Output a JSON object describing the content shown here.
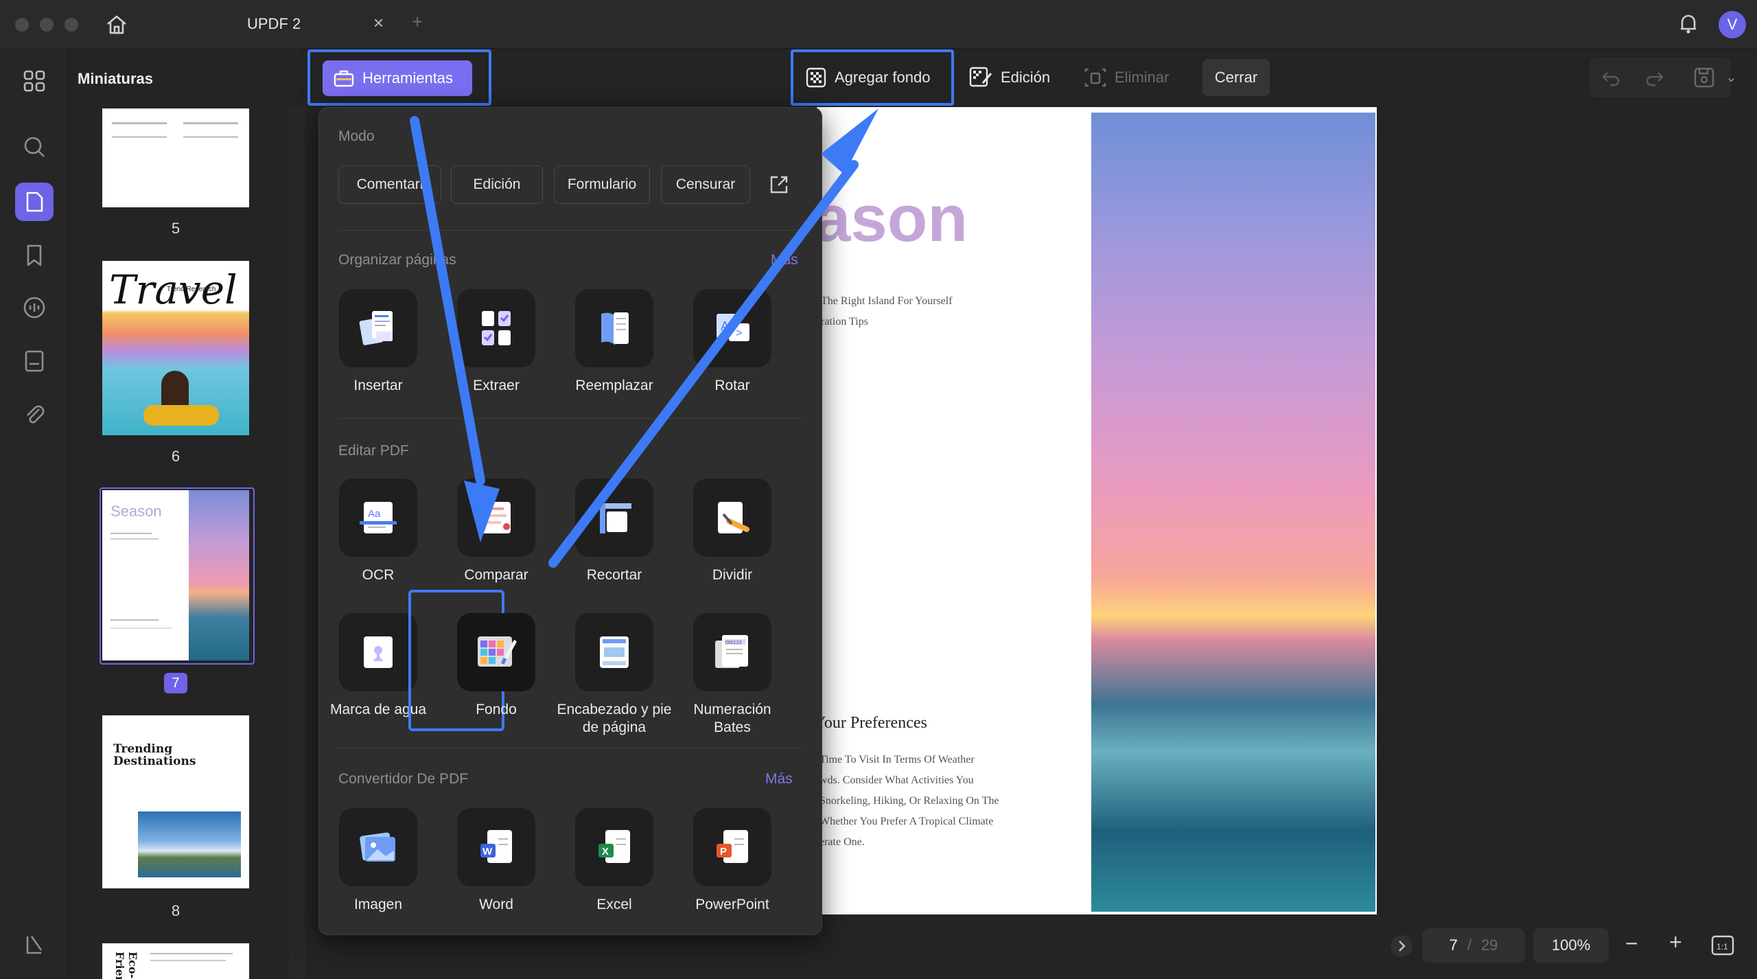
{
  "window": {
    "tab_title": "UPDF 2"
  },
  "sidebar": {
    "panel_title": "Miniaturas",
    "avatar_letter": "V"
  },
  "thumbnails": [
    {
      "page": "5"
    },
    {
      "page": "6",
      "title": "Travel",
      "subtitle": "Trend Research"
    },
    {
      "page": "7",
      "title": "Season"
    },
    {
      "page": "8",
      "title": "Trending Destinations"
    },
    {
      "page": "",
      "title": "Eco-Frien"
    }
  ],
  "toolbar": {
    "tools_button": "Herramientas",
    "add_background": "Agregar fondo",
    "edit": "Edición",
    "delete": "Eliminar",
    "close": "Cerrar"
  },
  "popover": {
    "mode_title": "Modo",
    "mode_chips": [
      "Comentari",
      "Edición",
      "Formulario",
      "Censurar"
    ],
    "organize_title": "Organizar páginas",
    "organize_more": "Más",
    "organize_tools": [
      "Insertar",
      "Extraer",
      "Reemplazar",
      "Rotar"
    ],
    "edit_title": "Editar PDF",
    "edit_tools_row1": [
      "OCR",
      "Comparar",
      "Recortar",
      "Dividir"
    ],
    "edit_tools_row2": [
      "Marca de agua",
      "Fondo",
      "Encabezado y pie de página",
      "Numeración Bates"
    ],
    "converter_title": "Convertidor De PDF",
    "converter_more": "Más",
    "converter_tools": [
      "Imagen",
      "Word",
      "Excel",
      "PowerPoint"
    ]
  },
  "document": {
    "heading": "ason",
    "line1": "The Right Island For Yourself",
    "line2": "ration Tips",
    "sub_heading": "Your Preferences",
    "para": [
      "Time To Visit In Terms Of Weather",
      "wds. Consider What Activities You",
      "Snorkeling, Hiking, Or Relaxing On The",
      "Whether You Prefer A Tropical Climate",
      "erate One."
    ]
  },
  "statusbar": {
    "current_page": "7",
    "separator": "/",
    "total_pages": "29",
    "zoom": "100%"
  },
  "colors": {
    "accent": "#3d7af5",
    "active_chip": "#6f63e6",
    "heading_purple": "#c5a6d9"
  }
}
